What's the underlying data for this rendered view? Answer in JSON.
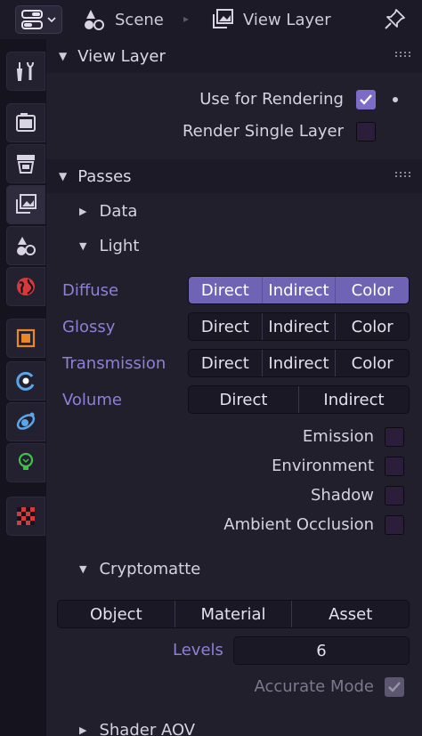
{
  "header": {
    "scene_label": "Scene",
    "view_layer_label": "View Layer",
    "separator": "▸"
  },
  "panels": {
    "view_layer": {
      "title": "View Layer",
      "use_for_rendering_label": "Use for Rendering",
      "use_for_rendering": true,
      "render_single_layer_label": "Render Single Layer",
      "render_single_layer": false
    },
    "passes": {
      "title": "Passes",
      "data_label": "Data",
      "light_label": "Light",
      "rows": [
        {
          "label": "Diffuse",
          "buttons": [
            "Direct",
            "Indirect",
            "Color"
          ],
          "active": true
        },
        {
          "label": "Glossy",
          "buttons": [
            "Direct",
            "Indirect",
            "Color"
          ],
          "active": false
        },
        {
          "label": "Transmission",
          "buttons": [
            "Direct",
            "Indirect",
            "Color"
          ],
          "active": false
        },
        {
          "label": "Volume",
          "buttons": [
            "Direct",
            "Indirect"
          ],
          "active": false
        }
      ],
      "checks": [
        {
          "label": "Emission",
          "value": false
        },
        {
          "label": "Environment",
          "value": false
        },
        {
          "label": "Shadow",
          "value": false
        },
        {
          "label": "Ambient Occlusion",
          "value": false
        }
      ]
    },
    "cryptomatte": {
      "title": "Cryptomatte",
      "buttons": [
        "Object",
        "Material",
        "Asset"
      ],
      "levels_label": "Levels",
      "levels_value": "6",
      "accurate_mode_label": "Accurate Mode",
      "accurate_mode": true
    },
    "shader_aov": {
      "title": "Shader AOV"
    }
  },
  "tabs": [
    {
      "name": "tool",
      "icon": "wrench-screwdriver-icon"
    },
    {
      "name": "render",
      "icon": "camera-back-icon"
    },
    {
      "name": "output",
      "icon": "printer-icon"
    },
    {
      "name": "view-layer",
      "icon": "images-icon",
      "active": true
    },
    {
      "name": "scene",
      "icon": "scene-cone-sphere-icon"
    },
    {
      "name": "world",
      "icon": "world-globe-icon"
    },
    {
      "name": "object",
      "icon": "object-square-icon"
    },
    {
      "name": "modifiers",
      "icon": "ring-dot-icon"
    },
    {
      "name": "particles",
      "icon": "orbit-icon"
    },
    {
      "name": "physics",
      "icon": "lightbulb-icon"
    },
    {
      "name": "texture",
      "icon": "checkerboard-icon"
    }
  ],
  "colors": {
    "accent": "#6f63b5",
    "accent_text": "#8e80d6",
    "panel_bg": "#211f2c",
    "header_bg": "#1c1a26"
  }
}
